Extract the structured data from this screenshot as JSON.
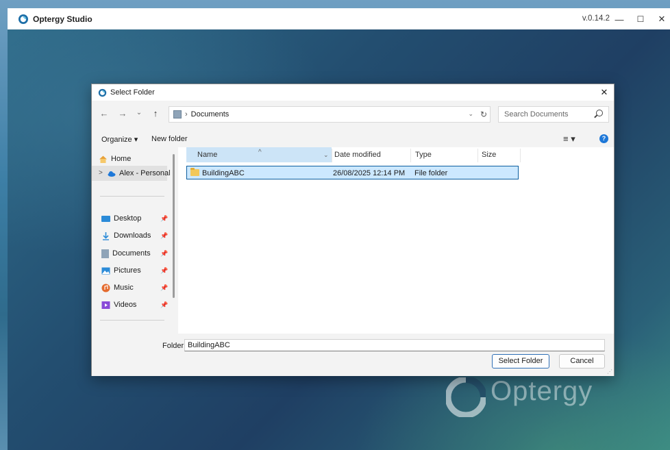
{
  "app": {
    "title": "Optergy Studio",
    "version": "v.0.14.2",
    "brand_word": "Optergy",
    "controls": {
      "minimize": "—",
      "maximize": "☐",
      "close": "✕"
    }
  },
  "dialog": {
    "title": "Select Folder",
    "close": "✕",
    "nav": {
      "back": "←",
      "forward": "→",
      "recent": "⌄",
      "up": "↑"
    },
    "address": {
      "separator": "›",
      "path": "Documents",
      "dropdown": "⌄",
      "refresh": "↻"
    },
    "search": {
      "placeholder": "Search Documents"
    },
    "toolbar": {
      "organize": "Organize ▾",
      "new_folder": "New folder",
      "view": "≡ ▾",
      "help": "?"
    },
    "nav_pane": {
      "home": "Home",
      "onedrive": "Alex - Personal",
      "expand": ">",
      "quick_access": [
        {
          "label": "Desktop",
          "icon": "desktop-icon",
          "color": "#2b8bd8"
        },
        {
          "label": "Downloads",
          "icon": "download-icon",
          "color": "#2b8bd8"
        },
        {
          "label": "Documents",
          "icon": "document-icon",
          "color": "#8fa4b8"
        },
        {
          "label": "Pictures",
          "icon": "pictures-icon",
          "color": "#2b8bd8"
        },
        {
          "label": "Music",
          "icon": "music-icon",
          "color": "#e46b2e"
        },
        {
          "label": "Videos",
          "icon": "videos-icon",
          "color": "#8a4bd8"
        }
      ],
      "pin_glyph": "📌"
    },
    "columns": {
      "name": "Name",
      "date": "Date modified",
      "type": "Type",
      "size": "Size",
      "sort_glyph": "^"
    },
    "rows": [
      {
        "name": "BuildingABC",
        "date": "26/08/2025 12:14 PM",
        "type": "File folder",
        "size": ""
      }
    ],
    "footer": {
      "folder_label": "Folder:",
      "folder_value": "BuildingABC",
      "select_button": "Select Folder",
      "cancel_button": "Cancel"
    }
  }
}
